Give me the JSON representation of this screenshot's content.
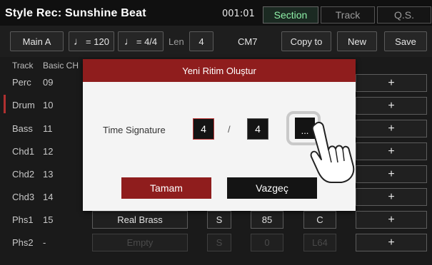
{
  "header": {
    "title": "Style Rec: Sunshine Beat",
    "time": "001:01",
    "tabs": [
      "Section",
      "Track",
      "Q.S."
    ],
    "active_tab": "Section"
  },
  "toolbar": {
    "section": "Main A",
    "tempo": "= 120",
    "meter": "= 4/4",
    "len_label": "Len",
    "len_value": "4",
    "chord": "CM7",
    "copy_to": "Copy to",
    "new": "New",
    "save": "Save"
  },
  "columns": [
    "Track",
    "Basic CH"
  ],
  "tracks": [
    {
      "name": "Perc",
      "ch": "09"
    },
    {
      "name": "Drum",
      "ch": "10"
    },
    {
      "name": "Bass",
      "ch": "11"
    },
    {
      "name": "Chd1",
      "ch": "12"
    },
    {
      "name": "Chd2",
      "ch": "13"
    },
    {
      "name": "Chd3",
      "ch": "14"
    },
    {
      "name": "Phs1",
      "ch": "15",
      "voice": "Real Brass",
      "s": "S",
      "vol": "85",
      "key": "C"
    },
    {
      "name": "Phs2",
      "ch": "-",
      "voice": "Empty",
      "s": "S",
      "vol": "0",
      "key": "L64"
    }
  ],
  "plus_label": "+",
  "dialog": {
    "title": "Yeni Ritim Oluştur",
    "label": "Time Signature",
    "numerator": "4",
    "slash": "/",
    "denominator": "4",
    "more": "...",
    "ok": "Tamam",
    "cancel": "Vazgeç",
    "ok_color": "#8f1d1d",
    "cancel_color": "#141414"
  }
}
